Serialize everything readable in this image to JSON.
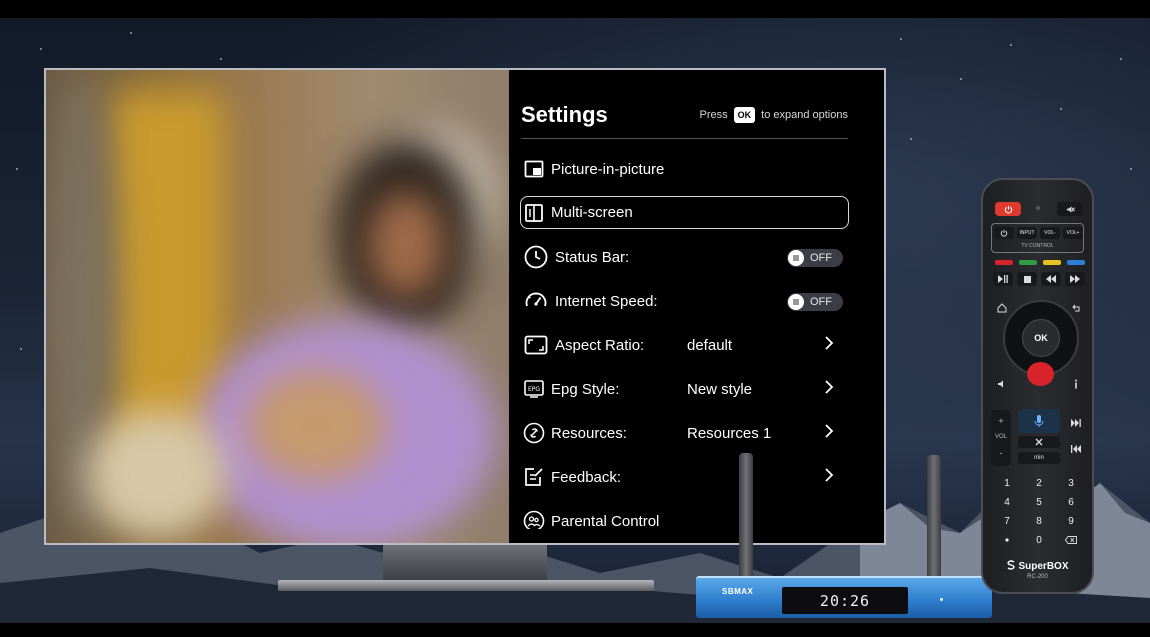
{
  "settings": {
    "title": "Settings",
    "hint_press": "Press",
    "hint_key": "OK",
    "hint_suffix": "to expand options",
    "items": [
      {
        "label": "Picture-in-picture",
        "icon": "pip-icon"
      },
      {
        "label": "Multi-screen",
        "icon": "multi-screen-icon",
        "focused": true
      },
      {
        "label": "Status Bar:",
        "icon": "clock-icon",
        "toggle": "OFF"
      },
      {
        "label": "Internet Speed:",
        "icon": "speedometer-icon",
        "toggle": "OFF"
      },
      {
        "label": "Aspect Ratio:",
        "icon": "aspect-ratio-icon",
        "value": "default"
      },
      {
        "label": "Epg Style:",
        "icon": "epg-icon",
        "icon_text": "EPG",
        "value": "New style"
      },
      {
        "label": "Resources:",
        "icon": "resources-icon",
        "value": "Resources 1"
      },
      {
        "label": "Feedback:",
        "icon": "feedback-icon"
      },
      {
        "label": "Parental Control",
        "icon": "parental-control-icon"
      }
    ]
  },
  "box": {
    "brand": "SBMAX",
    "time": "20:26"
  },
  "remote": {
    "brand": "SuperBOX",
    "model": "RC-200",
    "tv_control": {
      "input": "INPUT",
      "vol_down": "VOL-",
      "vol_up": "VOL+",
      "caption": "TV CONTROL"
    },
    "ok": "OK",
    "vol": "VOL",
    "min_label": "min",
    "digits": [
      "1",
      "2",
      "3",
      "4",
      "5",
      "6",
      "7",
      "8",
      "9",
      "0"
    ]
  },
  "colors": {
    "remote_power": "#e03a2f",
    "remote_red": "#d8232a",
    "remote_green": "#2f9b45",
    "remote_yellow": "#e8c21e",
    "remote_blue": "#2b7fd6",
    "box_blue": "#2f7fcf"
  }
}
